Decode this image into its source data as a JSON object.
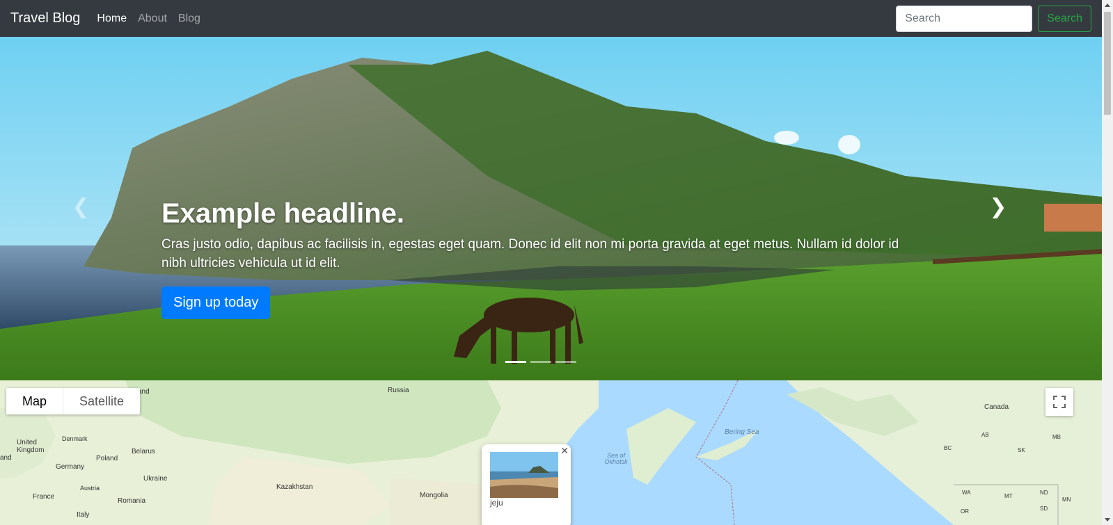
{
  "navbar": {
    "brand": "Travel Blog",
    "links": [
      "Home",
      "About",
      "Blog"
    ],
    "active_link": "Home",
    "search_placeholder": "Search",
    "search_button": "Search"
  },
  "carousel": {
    "headline": "Example headline.",
    "text": "Cras justo odio, dapibus ac facilisis in, egestas eget quam. Donec id elit non mi porta gravida at eget metus. Nullam id dolor id nibh ultricies vehicula ut id elit.",
    "button": "Sign up today",
    "slide_count": 3,
    "active_slide": 1
  },
  "map": {
    "map_type_options": [
      "Map",
      "Satellite"
    ],
    "selected_type": "Map",
    "labels": {
      "russia": "Russia",
      "canada": "Canada",
      "united_kingdom": "United Kingdom",
      "denmark": "Denmark",
      "belarus": "Belarus",
      "poland": "Poland",
      "germany": "Germany",
      "ukraine": "Ukraine",
      "austria": "Austria",
      "france": "France",
      "romania": "Romania",
      "kazakhstan": "Kazakhstan",
      "mongolia": "Mongolia",
      "italy": "Italy",
      "ireland_partial": "and",
      "finland_partial": "and",
      "sea_okhotsk": "Sea of Okhotsk",
      "bering_sea": "Bering Sea",
      "ab": "AB",
      "bc": "BC",
      "mb": "MB",
      "sk": "SK",
      "wa": "WA",
      "mt": "MT",
      "nd": "ND",
      "mn": "MN",
      "sd": "SD",
      "or": "OR"
    },
    "info_window": {
      "label": "jeju"
    }
  },
  "colors": {
    "navbar_bg": "#343a40",
    "primary": "#007bff",
    "success": "#28a745"
  }
}
